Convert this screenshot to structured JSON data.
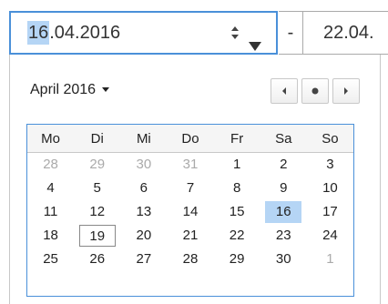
{
  "start_field": {
    "seg_day": "16",
    "rest": ".04.2016"
  },
  "range_separator": "-",
  "end_field": {
    "value": "22.04."
  },
  "month_title": "April 2016",
  "weekdays": [
    "Mo",
    "Di",
    "Mi",
    "Do",
    "Fr",
    "Sa",
    "So"
  ],
  "weeks": [
    [
      "28",
      "29",
      "30",
      "31",
      "1",
      "2",
      "3"
    ],
    [
      "4",
      "5",
      "6",
      "7",
      "8",
      "9",
      "10"
    ],
    [
      "11",
      "12",
      "13",
      "14",
      "15",
      "16",
      "17"
    ],
    [
      "18",
      "19",
      "20",
      "21",
      "22",
      "23",
      "24"
    ],
    [
      "25",
      "26",
      "27",
      "28",
      "29",
      "30",
      "1"
    ]
  ],
  "other_month_cells": [
    [
      0,
      0
    ],
    [
      0,
      1
    ],
    [
      0,
      2
    ],
    [
      0,
      3
    ],
    [
      4,
      6
    ]
  ],
  "selected_cell": [
    2,
    5
  ],
  "today_cell": [
    3,
    1
  ],
  "colors": {
    "accent": "#4a90d9",
    "selection": "#b5d5f5",
    "muted_day": "#aaaaaa"
  },
  "icons": {
    "spin": "spin-updown-icon",
    "dropdown": "dropdown-arrow-icon",
    "prev": "prev-month-icon",
    "today": "today-dot-icon",
    "next": "next-month-icon",
    "caret": "month-caret-icon"
  }
}
